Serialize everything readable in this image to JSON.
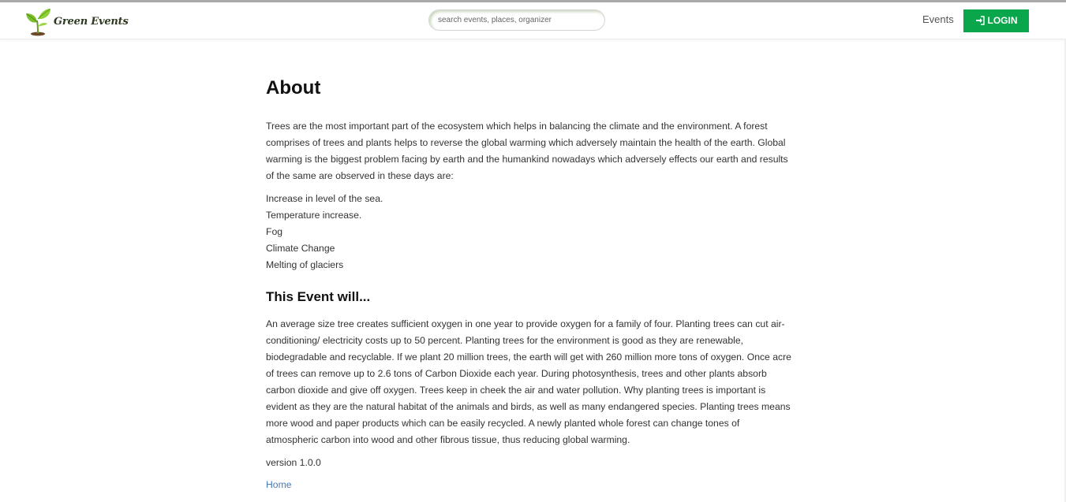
{
  "header": {
    "brand_name": "Green Events",
    "search_placeholder": "search events, places, organizer",
    "nav_events": "Events",
    "login_label": "LOGIN",
    "accent_color": "#0aa64b"
  },
  "main": {
    "title": "About",
    "intro": "Trees are the most important part of the ecosystem which helps in balancing the climate and the environment. A forest comprises of trees and plants helps to reverse the global warming which adversely maintain the health of the earth. Global warming is the biggest problem facing by earth and the humankind nowadays which adversely effects our earth and results of the same are observed in these days are:",
    "effects": [
      "Increase in level of the sea.",
      "Temperature increase.",
      "Fog",
      "Climate Change",
      "Melting of glaciers"
    ],
    "subtitle": "This Event will...",
    "body": "An average size tree creates sufficient oxygen in one year to provide oxygen for a family of four. Planting trees can cut air-conditioning/ electricity costs up to 50 percent. Planting trees for the environment is good as they are renewable, biodegradable and recyclable. If we plant 20 million trees, the earth will get with 260 million more tons of oxygen. Once acre of trees can remove up to 2.6 tons of Carbon Dioxide each year. During photosynthesis, trees and other plants absorb carbon dioxide and give off oxygen. Trees keep in cheek the air and water pollution. Why planting trees is important is evident as they are the natural habitat of the animals and birds, as well as many endangered species. Planting trees means more wood and paper products which can be easily recycled. A newly planted whole forest can change tones of atmospheric carbon into wood and other fibrous tissue, thus reducing global warming.",
    "version": "version 1.0.0",
    "home_link": "Home"
  }
}
